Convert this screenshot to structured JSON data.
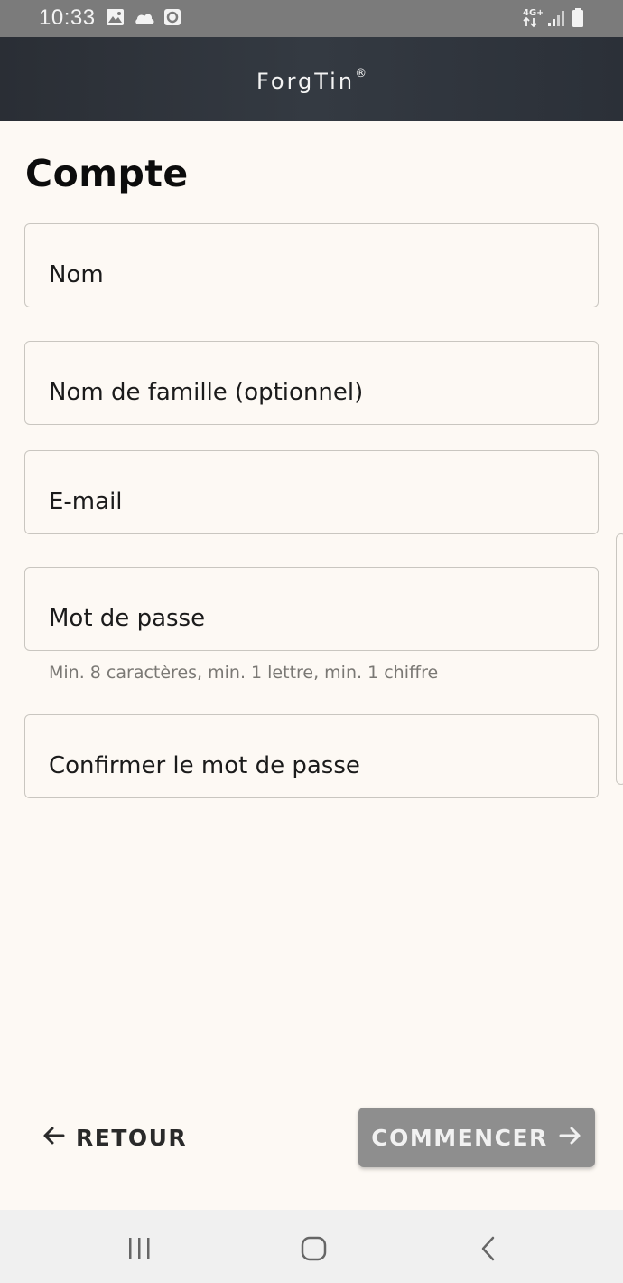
{
  "status_bar": {
    "time": "10:33",
    "network": "4G+",
    "icons": [
      "gallery-icon",
      "cloud-icon",
      "sync-icon",
      "network-4g-icon",
      "signal-icon",
      "battery-icon"
    ]
  },
  "header": {
    "logo": "ForgTin",
    "logo_mark": "®"
  },
  "page": {
    "title": "Compte"
  },
  "form": {
    "first_name_placeholder": "Nom",
    "last_name_placeholder": "Nom de famille (optionnel)",
    "email_placeholder": "E-mail",
    "password_placeholder": "Mot de passe",
    "password_hint": "Min. 8 caractères, min. 1 lettre, min. 1 chiffre",
    "confirm_password_placeholder": "Confirmer le mot de passe"
  },
  "actions": {
    "back_label": "RETOUR",
    "start_label": "COMMENCER"
  },
  "nav": {
    "icons": [
      "recent-apps-icon",
      "home-icon",
      "back-nav-icon"
    ]
  },
  "colors": {
    "background": "#fdf9f4",
    "header": "#30353d",
    "start_button": "#8e8e8e",
    "field_border": "#c9c6c0"
  }
}
